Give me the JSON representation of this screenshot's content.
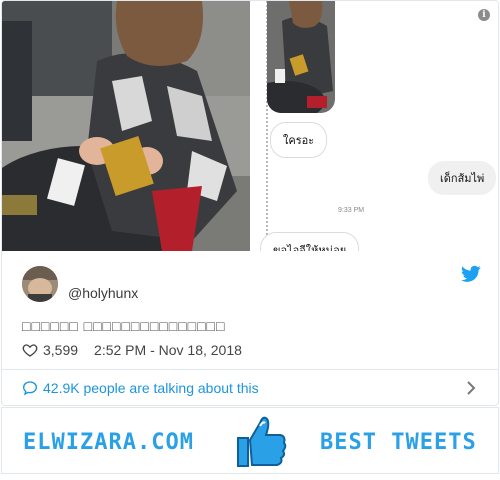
{
  "media": {
    "chat": {
      "messages": [
        {
          "text": "ใครอะ",
          "side": "in"
        },
        {
          "text": "เด็กส้มไพ่",
          "side": "out"
        },
        {
          "text": "ขอไอจีให้หน่อย",
          "side": "in"
        }
      ],
      "time": "9:33 PM"
    }
  },
  "tweet": {
    "handle": "@holyhunx",
    "text": "□□□□□□ □□□□□□□□□□□□□□□",
    "likes": "3,599",
    "timestamp": "2:52 PM - Nov 18, 2018",
    "talking": "42.9K people are talking about this"
  },
  "banner": {
    "brand": "ELWIZARA.COM",
    "tagline": "BEST TWEETS"
  },
  "colors": {
    "accent": "#1b95e0",
    "banner_text": "#2aa1e7",
    "bird": "#1da1f2"
  },
  "icons": [
    "info-icon",
    "twitter-bird-icon",
    "heart-icon",
    "comment-bubble-icon",
    "chevron-right-icon",
    "thumbs-up-icon"
  ]
}
